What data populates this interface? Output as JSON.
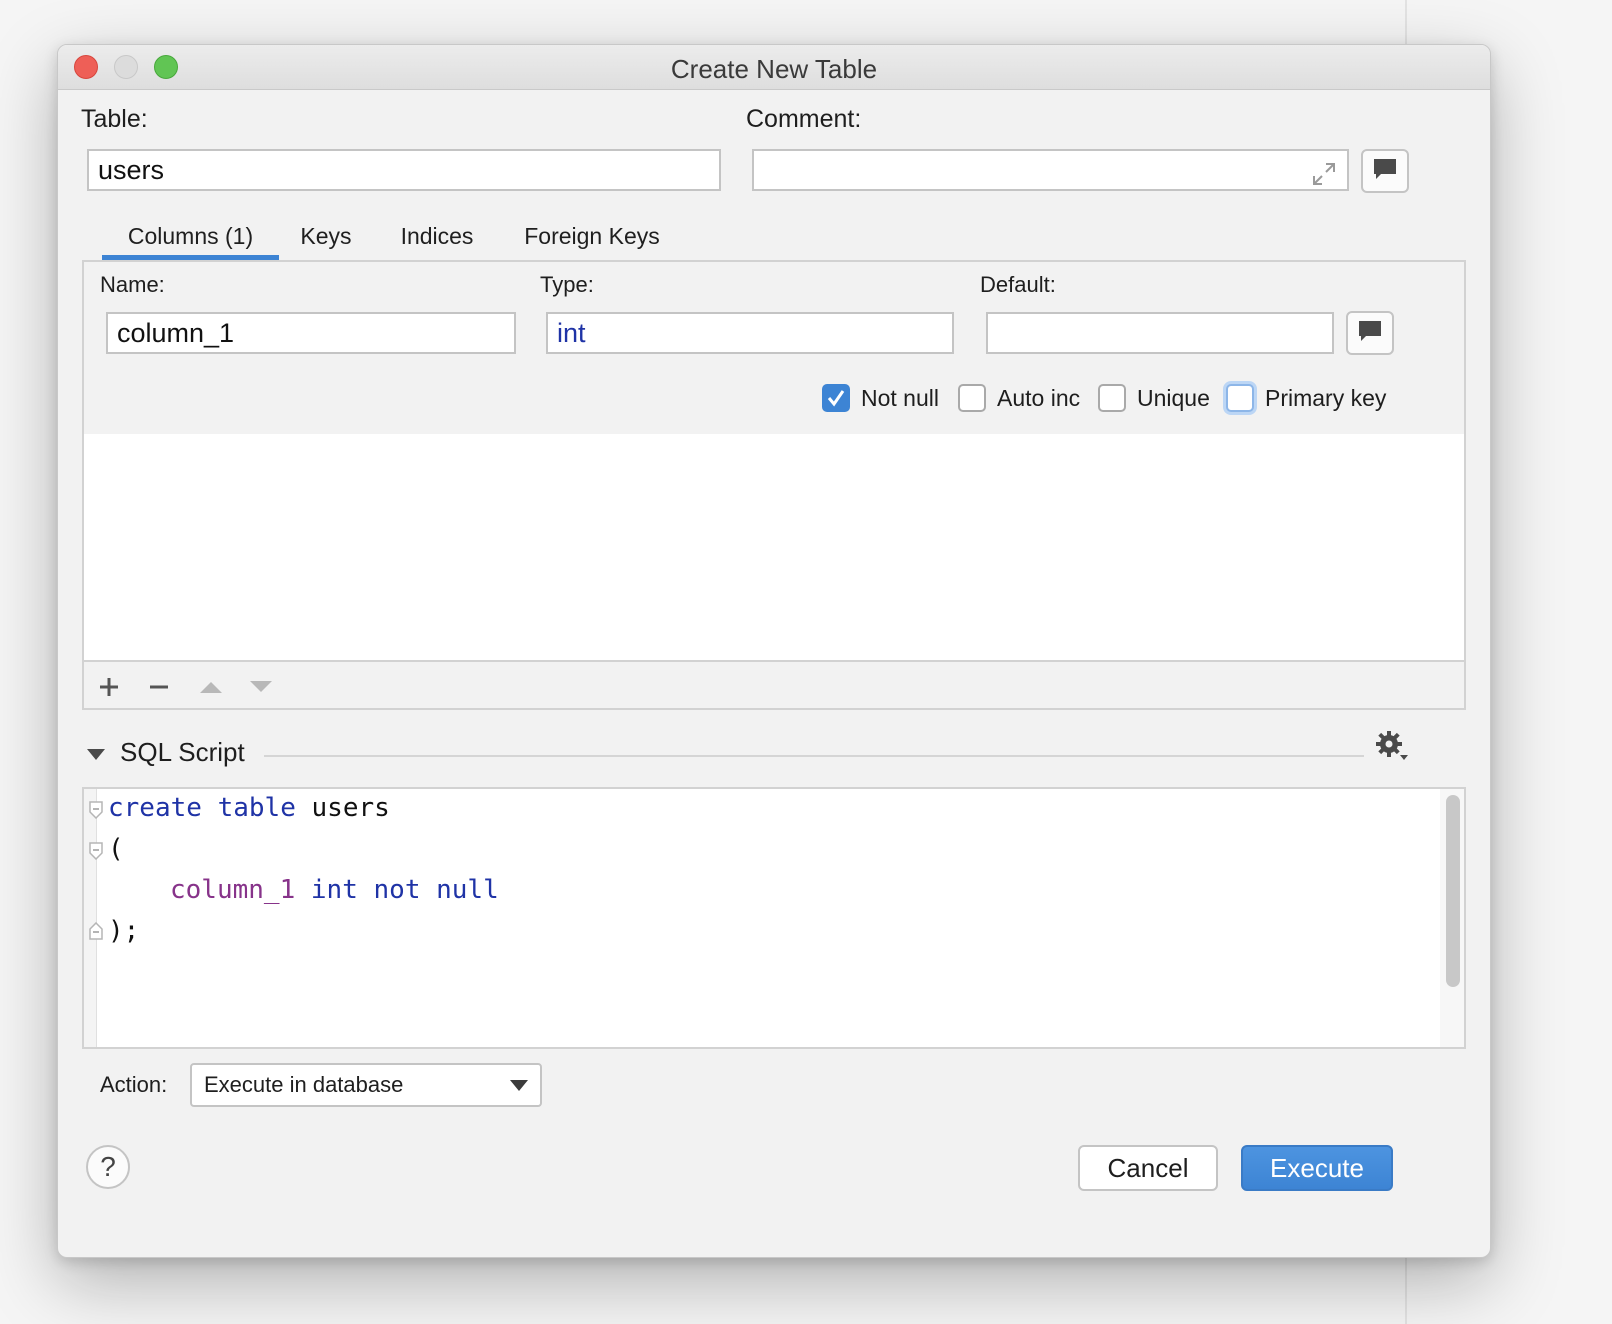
{
  "window": {
    "title": "Create New Table"
  },
  "table": {
    "label": "Table:",
    "value": "users"
  },
  "comment": {
    "label": "Comment:",
    "value": ""
  },
  "tabs": [
    {
      "label": "Columns (1)",
      "active": true
    },
    {
      "label": "Keys",
      "active": false
    },
    {
      "label": "Indices",
      "active": false
    },
    {
      "label": "Foreign Keys",
      "active": false
    }
  ],
  "column": {
    "name_label": "Name:",
    "name_value": "column_1",
    "type_label": "Type:",
    "type_value": "int",
    "default_label": "Default:",
    "default_value": ""
  },
  "options": [
    {
      "label": "Not null",
      "checked": true
    },
    {
      "label": "Auto inc",
      "checked": false
    },
    {
      "label": "Unique",
      "checked": false
    },
    {
      "label": "Primary key",
      "checked": false
    }
  ],
  "sql": {
    "section_title": "SQL Script",
    "lines": [
      {
        "kw1": "create",
        "kw2": "table",
        "name": "users"
      },
      {
        "text": "("
      },
      {
        "col": "column_1",
        "type": "int",
        "constraint": "not null"
      },
      {
        "text": ");"
      }
    ]
  },
  "action": {
    "label": "Action:",
    "selected": "Execute in database"
  },
  "buttons": {
    "cancel": "Cancel",
    "execute": "Execute",
    "help": "?"
  },
  "colors": {
    "accent": "#3d84d4",
    "keyword": "#1f33a6",
    "column_name": "#87338a"
  },
  "icons": {
    "expand": "expand-icon",
    "comment": "speech-bubble-icon",
    "add": "plus-icon",
    "remove": "minus-icon",
    "move_up": "arrow-up-icon",
    "move_down": "arrow-down-icon",
    "settings": "gear-icon",
    "collapse": "triangle-down-icon"
  }
}
